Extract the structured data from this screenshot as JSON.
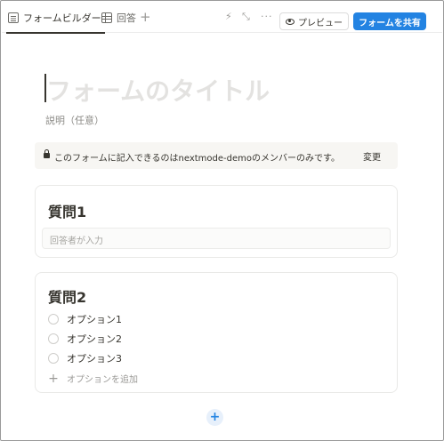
{
  "tabs": [
    {
      "label": "フォームビルダー",
      "icon": "form-doc-icon"
    },
    {
      "label": "回答",
      "icon": "table-icon"
    }
  ],
  "toolbar": {
    "add_tab_glyph": "+",
    "bolt_glyph": "⚡",
    "expand_glyph": "⤡",
    "more_glyph": "···",
    "preview_label": "プレビュー",
    "share_label": "フォームを共有",
    "share_color": "#2383e2"
  },
  "form": {
    "title_placeholder": "フォームのタイトル",
    "description_placeholder": "説明（任意）",
    "notice": {
      "text": "このフォームに記入できるのはnextmode-demoのメンバーのみです。",
      "action_label": "変更"
    },
    "questions": [
      {
        "title": "質問1",
        "input_placeholder": "回答者が入力"
      },
      {
        "title": "質問2",
        "options": [
          "オプション1",
          "オプション2",
          "オプション3"
        ],
        "add_option_label": "オプションを追加"
      }
    ],
    "add_question_glyph": "+"
  }
}
